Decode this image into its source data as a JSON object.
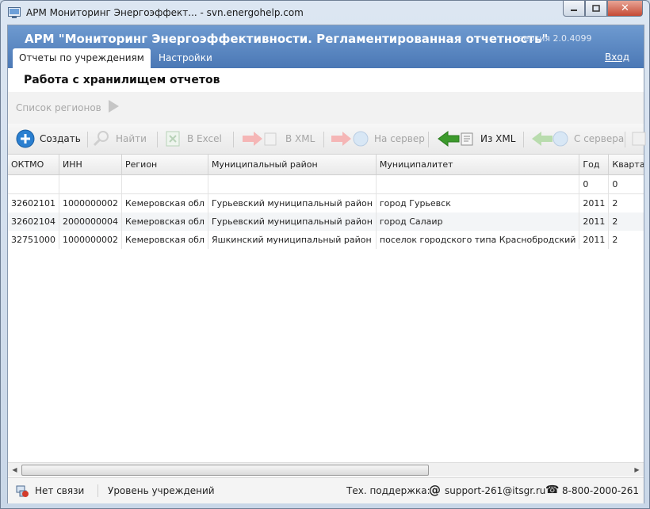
{
  "window": {
    "title": "АРМ Мониторинг Энергоэффект... - svn.energohelp.com",
    "icon": "app-icon"
  },
  "header": {
    "app_title": "АРМ \"Мониторинг Энергоэффективности. Регламентированная отчетность\"",
    "version": "версия 2.0.4099",
    "tabs": [
      {
        "label": "Отчеты по учреждениям",
        "active": true
      },
      {
        "label": "Настройки",
        "active": false
      }
    ],
    "exit_label": "Вход"
  },
  "section_title": "Работа с хранилищем отчетов",
  "region_bar": {
    "label": "Список регионов"
  },
  "toolbar": {
    "create": "Создать",
    "find": "Найти",
    "to_excel": "В Excel",
    "to_xml": "В XML",
    "to_server": "На сервер",
    "from_xml": "Из XML",
    "from_server": "С сервера"
  },
  "table": {
    "columns": [
      "ОКТМО",
      "ИНН",
      "Регион",
      "Муниципальный район",
      "Муниципалитет",
      "Год",
      "Квартал"
    ],
    "filter_row": [
      "",
      "",
      "",
      "",
      "",
      "0",
      "0"
    ],
    "rows": [
      [
        "32602101",
        "1000000002",
        "Кемеровская обл",
        "Гурьевский муниципальный район",
        "город Гурьевск",
        "2011",
        "2"
      ],
      [
        "32602104",
        "2000000004",
        "Кемеровская обл",
        "Гурьевский муниципальный район",
        "город Салаир",
        "2011",
        "2"
      ],
      [
        "32751000",
        "1000000002",
        "Кемеровская обл",
        "Яшкинский муниципальный район",
        "поселок городского типа Краснобродский",
        "2011",
        "2"
      ]
    ]
  },
  "status": {
    "connection": "Нет связи",
    "level": "Уровень учреждений",
    "support_label": "Тех. поддержка:",
    "email": "support-261@itsgr.ru",
    "phone": "8-800-2000-261"
  },
  "colors": {
    "header_blue": "#4b78b5",
    "create_blue": "#2a7fd0",
    "arrow_green": "#3c9a2c",
    "arrow_red_disabled": "#f2a0a0"
  }
}
